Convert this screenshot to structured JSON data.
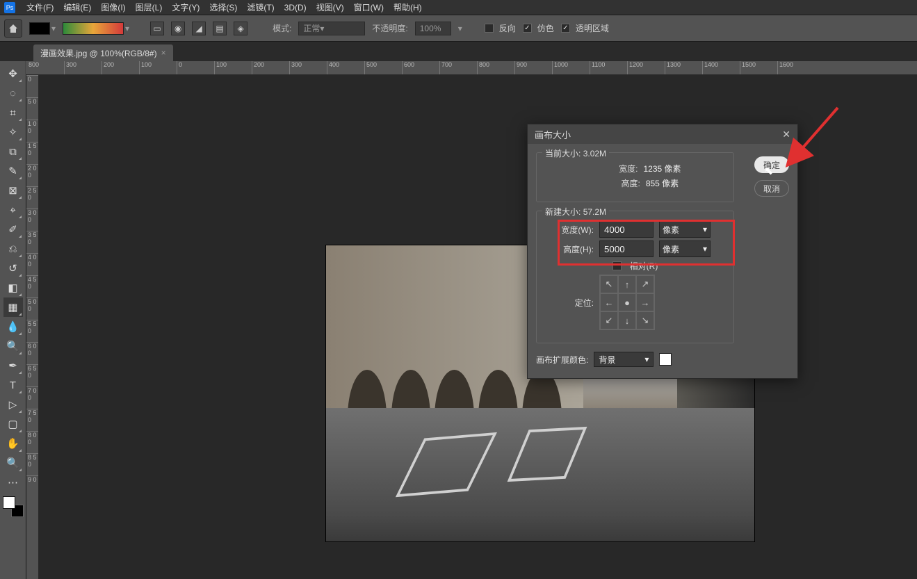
{
  "menubar": {
    "items": [
      "文件(F)",
      "编辑(E)",
      "图像(I)",
      "图层(L)",
      "文字(Y)",
      "选择(S)",
      "滤镜(T)",
      "3D(D)",
      "视图(V)",
      "窗口(W)",
      "帮助(H)"
    ]
  },
  "options": {
    "mode_label": "模式:",
    "mode_value": "正常",
    "opacity_label": "不透明度:",
    "opacity_value": "100%",
    "reverse": "反向",
    "dither": "仿色",
    "transparency": "透明区域"
  },
  "tab": {
    "title": "漫画效果.jpg @ 100%(RGB/8#)"
  },
  "hruler": [
    "800",
    "300",
    "200",
    "100",
    "0",
    "100",
    "200",
    "300",
    "400",
    "500",
    "600",
    "700",
    "800",
    "900",
    "1000",
    "1100",
    "1200",
    "1300",
    "1400",
    "1500",
    "1600"
  ],
  "vruler": [
    "0",
    "5 0",
    "1 0 0",
    "1 5 0",
    "2 0 0",
    "2 5 0",
    "3 0 0",
    "3 5 0",
    "4 0 0",
    "4 5 0",
    "5 0 0",
    "5 5 0",
    "6 0 0",
    "6 5 0",
    "7 0 0",
    "7 5 0",
    "8 0 0",
    "8 5 0",
    "9 0"
  ],
  "dialog": {
    "title": "画布大小",
    "current_label": "当前大小:",
    "current_size": "3.02M",
    "cur_width_label": "宽度:",
    "cur_width_value": "1235 像素",
    "cur_height_label": "高度:",
    "cur_height_value": "855 像素",
    "new_label": "新建大小:",
    "new_size": "57.2M",
    "width_label": "宽度(W):",
    "width_value": "4000",
    "height_label": "高度(H):",
    "height_value": "5000",
    "unit": "像素",
    "relative_label": "相对(R)",
    "anchor_label": "定位:",
    "ext_color_label": "画布扩展颜色:",
    "ext_color_value": "背景",
    "ok": "确定",
    "cancel": "取消"
  }
}
